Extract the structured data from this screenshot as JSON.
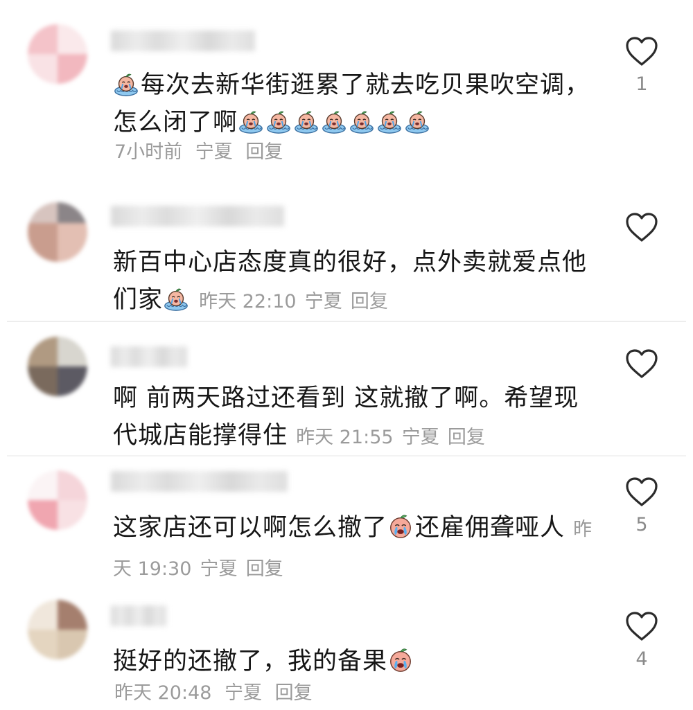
{
  "comments": [
    {
      "text_before": "每次去新华街逛累了就去吃贝果吹空调，怎么闭了啊",
      "time": "7小时前",
      "location": "宁夏",
      "reply": "回复",
      "likes": "1",
      "emoji": "crying-bagel-sticker"
    },
    {
      "text_before": "新百中心店态度真的很好，点外卖就爱点他们家",
      "time": "昨天 22:10",
      "location": "宁夏",
      "reply": "回复",
      "likes": "",
      "emoji": "crying-bagel-sticker"
    },
    {
      "text_before": "啊 前两天路过还看到 这就撤了啊。希望现代城店能撑得住",
      "time": "昨天 21:55",
      "location": "宁夏",
      "reply": "回复",
      "likes": ""
    },
    {
      "text_before": "这家店还可以啊怎么撤了",
      "text_after": "还雇佣聋哑人",
      "time": "昨天 19:30",
      "location": "宁夏",
      "reply": "回复",
      "likes": "5",
      "emoji": "crying-peach-emoji"
    },
    {
      "text_before": "挺好的还撤了，我的备果",
      "time": "昨天 20:48",
      "location": "宁夏",
      "reply": "回复",
      "likes": "4",
      "emoji": "crying-peach-emoji"
    }
  ],
  "colors": {
    "text": "#161616",
    "meta": "#9b9b9b",
    "divider": "#ededed"
  }
}
